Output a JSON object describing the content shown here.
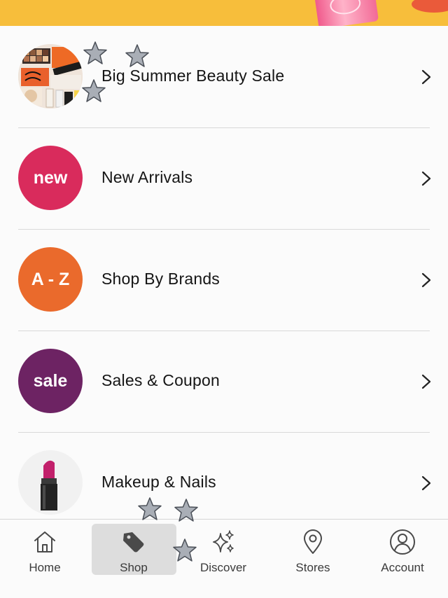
{
  "menu": {
    "items": [
      {
        "label": "Big Summer Beauty Sale",
        "badge": "",
        "icon": "beauty-products-photo"
      },
      {
        "label": "New Arrivals",
        "badge": "new",
        "color": "#d92b5c"
      },
      {
        "label": "Shop By Brands",
        "badge": "A - Z",
        "color": "#ea6a2c"
      },
      {
        "label": "Sales & Coupon",
        "badge": "sale",
        "color": "#6d2363"
      },
      {
        "label": "Makeup & Nails",
        "badge": "",
        "icon": "lipstick-photo"
      }
    ]
  },
  "tabbar": {
    "active": "Shop",
    "tabs": [
      {
        "label": "Home",
        "icon": "home-icon"
      },
      {
        "label": "Shop",
        "icon": "tag-icon"
      },
      {
        "label": "Discover",
        "icon": "sparkle-icon"
      },
      {
        "label": "Stores",
        "icon": "location-pin-icon"
      },
      {
        "label": "Account",
        "icon": "account-icon"
      }
    ]
  },
  "colors": {
    "banner": "#f7be3b",
    "accent_new": "#d92b5c",
    "accent_az": "#ea6a2c",
    "accent_sale": "#6d2363"
  }
}
